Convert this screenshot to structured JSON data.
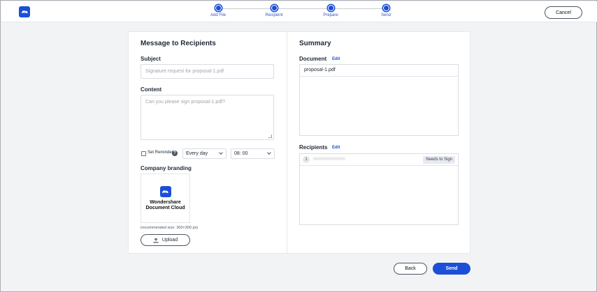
{
  "header": {
    "steps": [
      {
        "label": "Add File"
      },
      {
        "label": "Recipient"
      },
      {
        "label": "Prepare"
      },
      {
        "label": "Send"
      }
    ],
    "cancel_label": "Cancel"
  },
  "message": {
    "title": "Message to Recipients",
    "subject_label": "Subject",
    "subject_placeholder": "Signature request for proposal-1.pdf",
    "content_label": "Content",
    "content_placeholder": "Can you please sign proposal-1.pdf?",
    "reminder_label": "Set Reminder",
    "reminder_checked": false,
    "help_glyph": "?",
    "frequency_value": "Every day",
    "time_value": "08: 00",
    "branding_label": "Company branding",
    "brand_name_line1": "Wondershare",
    "brand_name_line2": "Document Cloud",
    "recommended_size": "(recommended size: 300×300 px)",
    "upload_label": "Upload"
  },
  "summary": {
    "title": "Summary",
    "document_label": "Document",
    "document_edit": "Edit",
    "document_name": "proposal-1.pdf",
    "recipients_label": "Recipients",
    "recipients_edit": "Edit",
    "recipients": [
      {
        "index": "1",
        "email": "••••••••••••••••••••",
        "role": "Needs to Sign"
      }
    ]
  },
  "footer": {
    "back_label": "Back",
    "send_label": "Send"
  },
  "colors": {
    "accent": "#1c4fd8",
    "background": "#f2f3f5"
  }
}
